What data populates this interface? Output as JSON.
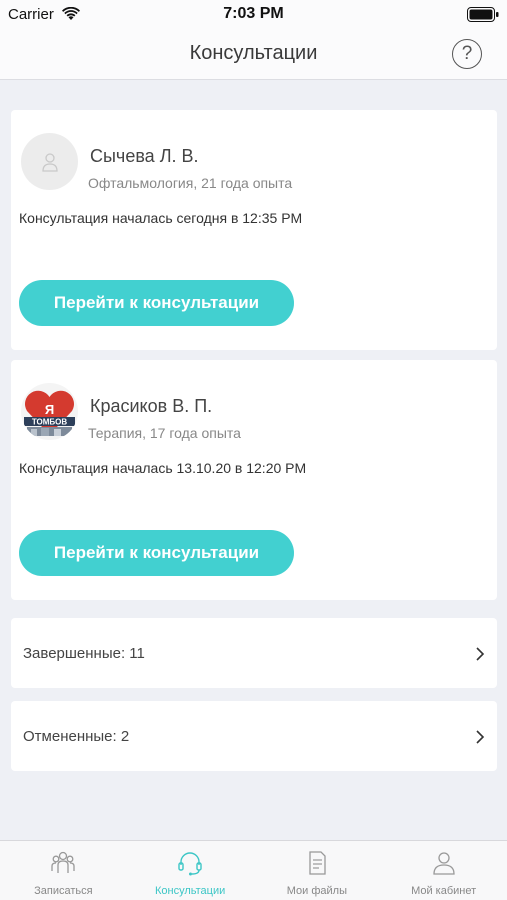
{
  "status_bar": {
    "carrier": "Carrier",
    "time": "7:03 PM"
  },
  "nav": {
    "title": "Консультации",
    "help_label": "?"
  },
  "consultations": [
    {
      "doctor_name": "Сычева Л. В.",
      "specialty": "Офтальмология, 21 года опыта",
      "status": "Консультация началась сегодня в 12:35 PM",
      "button_label": "Перейти к консультации",
      "avatar": "person-placeholder-icon"
    },
    {
      "doctor_name": "Красиков В. П.",
      "specialty": "Терапия, 17 года опыта",
      "status": "Консультация началась 13.10.20 в 12:20 PM",
      "button_label": "Перейти к консультации",
      "avatar": "photo",
      "avatar_text_top": "Я",
      "avatar_text_bottom": "ТОМБОВ"
    }
  ],
  "summary": {
    "completed_label": "Завершенные:  11",
    "cancelled_label": "Отмененные:  2"
  },
  "tabs": [
    {
      "label": "Записаться",
      "icon": "group-icon",
      "active": false
    },
    {
      "label": "Консультации",
      "icon": "headset-icon",
      "active": true
    },
    {
      "label": "Мои файлы",
      "icon": "document-icon",
      "active": false
    },
    {
      "label": "Мой кабинет",
      "icon": "user-icon",
      "active": false
    }
  ],
  "colors": {
    "accent": "#42d0d0",
    "active_tab": "#3cc6c6",
    "background": "#eef0f5"
  }
}
